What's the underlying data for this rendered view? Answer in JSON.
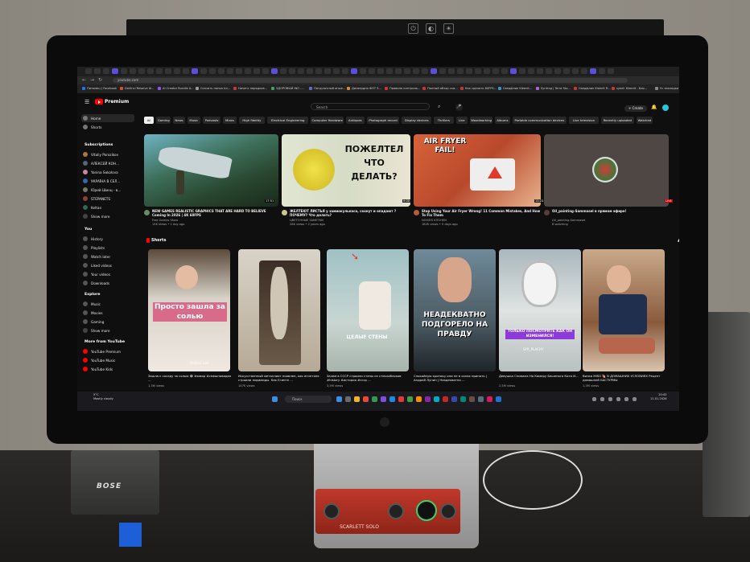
{
  "browser": {
    "url": "youtube.com",
    "bookmarks": [
      {
        "label": "Питомец | Facebook",
        "color": "#1877f2"
      },
      {
        "label": "DaVinci Resolve Ф...",
        "color": "#e04b2f"
      },
      {
        "label": "AI Creator Bundle A...",
        "color": "#8855ff"
      },
      {
        "label": "Скачать папка Ал...",
        "color": "#999999"
      },
      {
        "label": "Ничего порядков...",
        "color": "#cc3333"
      },
      {
        "label": "ЗДОРОВЫЙ INO -...",
        "color": "#33aa55"
      },
      {
        "label": "Погрузочный иные...",
        "color": "#6666cc"
      },
      {
        "label": "Дисвердно ФОТ З...",
        "color": "#dd8833"
      },
      {
        "label": "Правила контроль...",
        "color": "#cc3333"
      },
      {
        "label": "Полный обзор ски...",
        "color": "#cc3333"
      },
      {
        "label": "Как сделать 60FPS...",
        "color": "#cc3333"
      },
      {
        "label": "Сведфлик Kleenit...",
        "color": "#3399cc"
      },
      {
        "label": "Syntrog | Terra Sto...",
        "color": "#aa66cc"
      },
      {
        "label": "Сведфлик Kleenit R...",
        "color": "#cc3333"
      },
      {
        "label": "syedi: Kleenit - Боо...",
        "color": "#cc3333"
      }
    ],
    "other_bookmarks": "Уч закладки"
  },
  "header": {
    "logo_text": "Premium",
    "search_placeholder": "Search",
    "create_label": "+ Create"
  },
  "sidebar": {
    "main": [
      {
        "label": "Home",
        "icon": "home-icon"
      },
      {
        "label": "Shorts",
        "icon": "shorts-icon"
      }
    ],
    "subscriptions_title": "Subscriptions",
    "subscriptions": [
      {
        "label": "Vitaliy Porozikov",
        "color": "#aa7744"
      },
      {
        "label": "АЛЕКСЕЙ КОН...",
        "color": "#556677"
      },
      {
        "label": "Yanina Sokolova",
        "color": "#cc8899"
      },
      {
        "label": "УКРАЇНА В СЕЛ...",
        "color": "#3366aa"
      },
      {
        "label": "Юрий Шинц - в...",
        "color": "#777766"
      },
      {
        "label": "STEPANETS",
        "color": "#884433"
      },
      {
        "label": "Keltan",
        "color": "#336655"
      },
      {
        "label": "Show more",
        "color": "#444444"
      }
    ],
    "you_title": "You",
    "you": [
      {
        "label": "History",
        "color": "#555555"
      },
      {
        "label": "Playlists",
        "color": "#555555"
      },
      {
        "label": "Watch later",
        "color": "#555555"
      },
      {
        "label": "Liked videos",
        "color": "#555555"
      },
      {
        "label": "Your videos",
        "color": "#555555"
      },
      {
        "label": "Downloads",
        "color": "#555555"
      }
    ],
    "explore_title": "Explore",
    "explore": [
      {
        "label": "Music",
        "color": "#555555"
      },
      {
        "label": "Movies",
        "color": "#555555"
      },
      {
        "label": "Gaming",
        "color": "#555555"
      },
      {
        "label": "Show more",
        "color": "#444444"
      }
    ],
    "more_title": "More from YouTube",
    "more": [
      {
        "label": "YouTube Premium",
        "color": "#ff0000"
      },
      {
        "label": "YouTube Music",
        "color": "#ff0000"
      },
      {
        "label": "YouTube Kids",
        "color": "#ff0000"
      }
    ]
  },
  "chips": [
    "All",
    "Gaming",
    "News",
    "Music",
    "Podcasts",
    "Mixes",
    "High fidelity",
    "Electrical Engineering",
    "Computer Hardware",
    "Antiques",
    "Photograph record",
    "Display devices",
    "Thrillers",
    "Live",
    "Woodworking",
    "Albums",
    "Portable communication devices",
    "Live television",
    "Recently uploaded",
    "Watched"
  ],
  "videos": [
    {
      "title": "NEW GAMES REALISTIC GRAPHICS THAT ARE HARD TO BELIEVE Coming In 2026 | 4K 60FPS",
      "channel": "Free Games Show",
      "meta": "15K views • 1 day ago",
      "duration": "17:51",
      "overlay": ""
    },
    {
      "title": "ЖЕЛТЕЮТ ЛИСТЬЯ у замиокулькаса, сохнут и опадают ? ПОЧЕМУ? Что делать?",
      "channel": "ЦВЕТОЧНЫЕ ЗАМЕТКИ",
      "meta": "28K views • 2 years ago",
      "duration": "9:00",
      "overlay": "ПОЖЕЛТЕЛ ЧТО ДЕЛАТЬ?"
    },
    {
      "title": "Stop Using Your Air Fryer Wrong! 11 Common Mistakes, And How To Fix Them",
      "channel": "NOOB'S KITCHEN",
      "meta": "182K views • 5 days ago",
      "duration": "13:23",
      "overlay": "AIR FRYER FAIL!"
    },
    {
      "title": "Oil_painting-Sammasel в прямом эфире!",
      "channel": "Oil_painting-Sammasel",
      "meta": "8 watching",
      "duration": "LIVE",
      "overlay": ""
    }
  ],
  "shorts_title": "Shorts",
  "shorts": [
    {
      "title": "Зашла к соседу за солью 😂 #юмор #смешновидео ...",
      "views": "1,3M views",
      "overlay": "Просто зашла за солью",
      "tag": "VideoCook"
    },
    {
      "title": "Искусственный металлиот появлен, как египтяне строили пирамиды. Как Египте ...",
      "views": "147K views",
      "overlay": "",
      "tag": ""
    },
    {
      "title": "Зачем в СССР строили стены из стеклоблоков #history #история #ссср ...",
      "views": "3,5M views",
      "overlay": "ЦЕЛЫЕ СТЕНЫ",
      "tag": ""
    },
    {
      "title": "Спокойную критику они не в силах принять | Андрей Лунин | Неадекватно ...",
      "views": "",
      "overlay": "НЕАДЕКВАТНО ПОДГОРЕЛО НА ПРАВДУ",
      "tag": ""
    },
    {
      "title": "Девушка Снимала На Камеру Бешеного Кота И...",
      "views": "2,5M views",
      "overlay": "ТОЛЬКО ПОСМОТРИТЕ КАК ОН ИЗМЕНИЛСЯ!",
      "tag": "SYR_PLACHY"
    },
    {
      "title": "Вилка MISO 🍖 В ДОМАШНИХ УСЛОВИЯХ Рецепт домашней БАСТУРМЫ",
      "views": "1,3M views",
      "overlay": "",
      "tag": ""
    }
  ],
  "taskbar": {
    "search_label": "Поиск",
    "weather_temp": "5°C",
    "weather_desc": "Mostly cloudy",
    "time": "20:45",
    "date": "11.01.2026"
  },
  "hardware": {
    "speaker_brand": "BOSE",
    "interface_label": "SCARLETT SOLO"
  }
}
